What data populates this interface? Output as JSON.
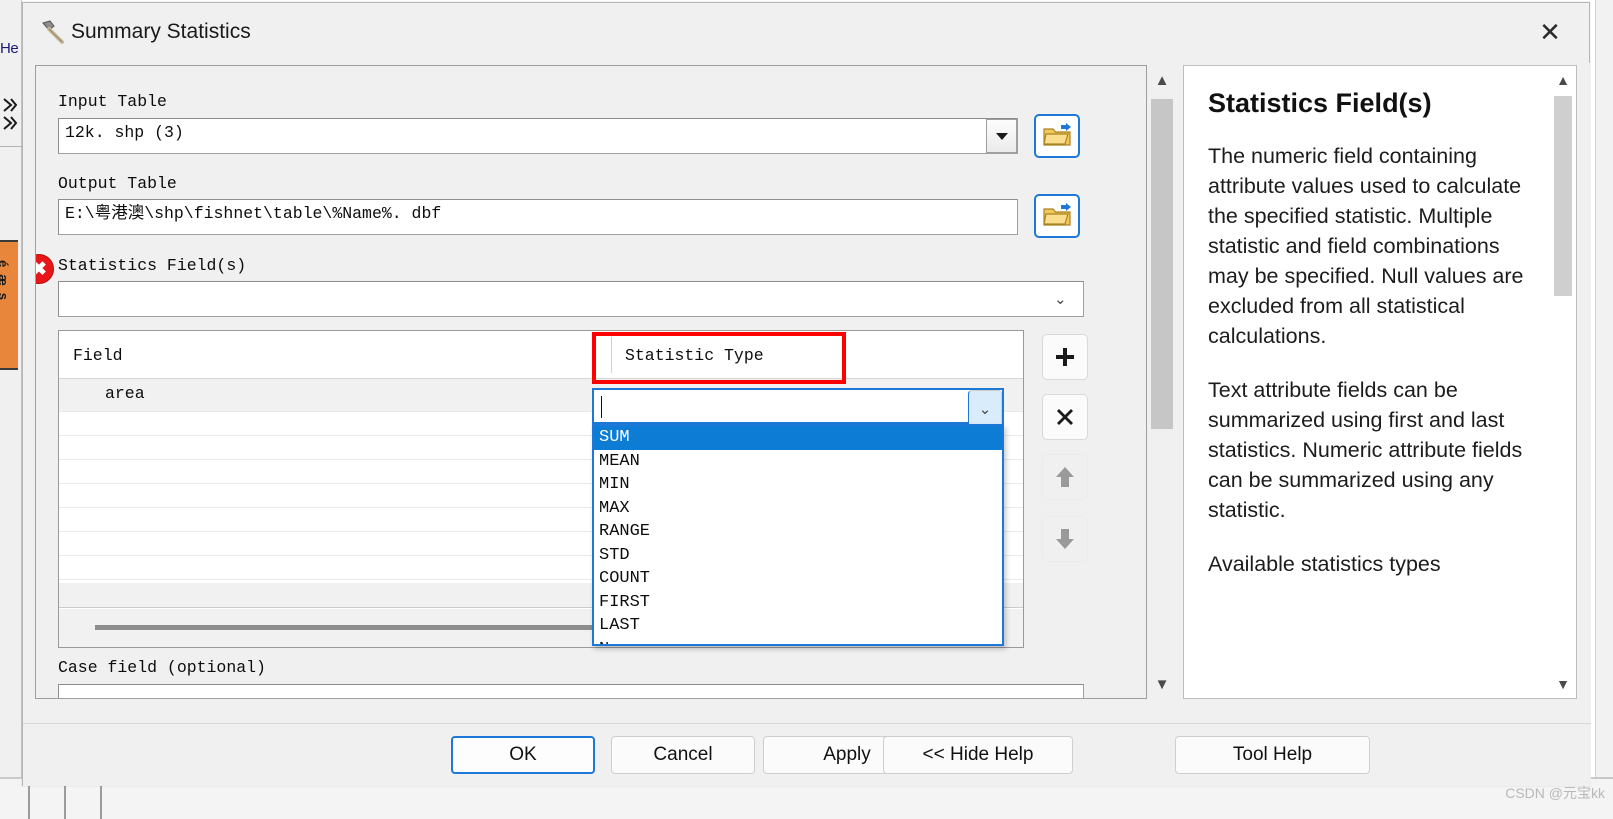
{
  "background": {
    "menu_fragment": "He",
    "side_tab_label": "éæs",
    "collapse_icons": [
      "chevron-collapse",
      "chevron-collapse"
    ]
  },
  "window": {
    "title": "Summary Statistics",
    "icon": "hammer-tool-icon",
    "close_label": "✕"
  },
  "params": {
    "input_table": {
      "label": "Input Table",
      "value": "12k. shp (3)",
      "browse_icon": "open-folder-icon"
    },
    "output_table": {
      "label": "Output Table",
      "value": "E:\\粤港澳\\shp\\fishnet\\table\\%Name%. dbf",
      "browse_icon": "open-folder-icon"
    },
    "statistics_fields": {
      "label": "Statistics Field(s)",
      "value": "",
      "error_icon": "error-x-icon",
      "dropdown_icon": "chevron-down-icon"
    },
    "case_field": {
      "label": "Case field (optional)",
      "value": ""
    }
  },
  "field_table": {
    "columns": [
      "Field",
      "Statistic Type"
    ],
    "rows": [
      {
        "field": "area",
        "statistic_type": ""
      }
    ],
    "highlight_color": "#ff0000",
    "editor": {
      "value": "",
      "dropdown_icon": "chevron-down-icon",
      "options": [
        "SUM",
        "MEAN",
        "MIN",
        "MAX",
        "RANGE",
        "STD",
        "COUNT",
        "FIRST",
        "LAST",
        "Name"
      ],
      "selected": "SUM"
    },
    "side_buttons": [
      {
        "name": "add-row-button",
        "icon": "plus-icon",
        "glyph": "➕",
        "enabled": true
      },
      {
        "name": "remove-row-button",
        "icon": "cross-icon",
        "glyph": "✖",
        "enabled": true
      },
      {
        "name": "move-up-button",
        "icon": "arrow-up-icon",
        "glyph": "⬆",
        "enabled": false
      },
      {
        "name": "move-down-button",
        "icon": "arrow-down-icon",
        "glyph": "⬇",
        "enabled": false
      }
    ]
  },
  "help": {
    "title": "Statistics Field(s)",
    "paragraphs": [
      "The numeric field containing attribute values used to calculate the specified statistic. Multiple statistic and field combinations may be specified. Null values are excluded from all statistical calculations.",
      "Text attribute fields can be summarized using first and last statistics. Numeric attribute fields can be summarized using any statistic.",
      "Available statistics types"
    ]
  },
  "footer": {
    "buttons": [
      {
        "name": "ok-button",
        "label": "OK",
        "primary": true
      },
      {
        "name": "cancel-button",
        "label": "Cancel",
        "primary": false
      },
      {
        "name": "apply-button",
        "label": "Apply",
        "primary": false
      },
      {
        "name": "hide-help-button",
        "label": "<< Hide Help",
        "primary": false
      },
      {
        "name": "tool-help-button",
        "label": "Tool Help",
        "primary": false
      }
    ]
  },
  "watermark": "CSDN @元宝kk"
}
